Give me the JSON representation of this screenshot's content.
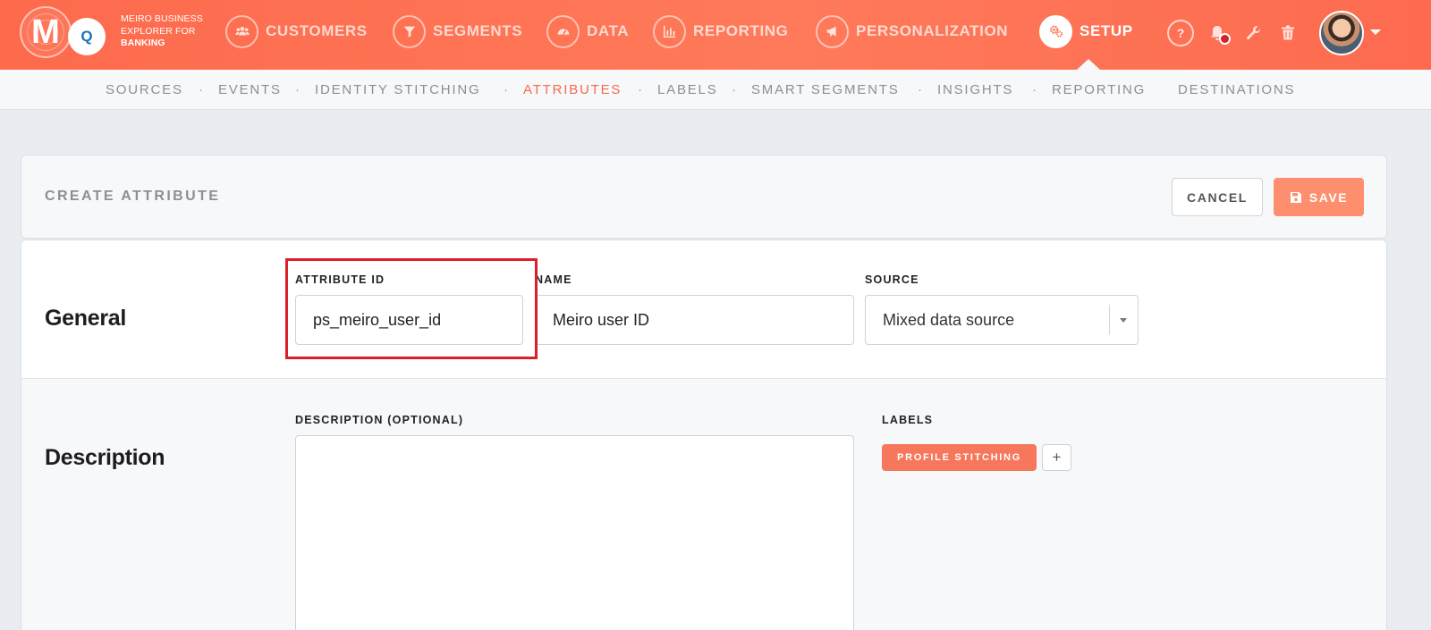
{
  "brand": {
    "logo_letter": "M",
    "logo_q": "Q",
    "line1": "MEIRO BUSINESS",
    "line2": "EXPLORER FOR",
    "line3": "BANKING"
  },
  "nav": {
    "customers": "CUSTOMERS",
    "segments": "SEGMENTS",
    "data": "DATA",
    "reporting": "REPORTING",
    "personalization": "PERSONALIZATION",
    "setup": "SETUP"
  },
  "tools": {
    "help": "?"
  },
  "subnav": {
    "sources": "SOURCES",
    "events": "EVENTS",
    "identity_stitching": "IDENTITY STITCHING",
    "attributes": "ATTRIBUTES",
    "labels": "LABELS",
    "smart_segments": "SMART SEGMENTS",
    "insights": "INSIGHTS",
    "reporting": "REPORTING",
    "destinations": "DESTINATIONS",
    "separator": "·"
  },
  "header": {
    "title": "CREATE ATTRIBUTE",
    "cancel_label": "CANCEL",
    "save_label": "SAVE"
  },
  "general": {
    "title": "General",
    "attribute_id_label": "ATTRIBUTE ID",
    "attribute_id_value": "ps_meiro_user_id",
    "name_label": "NAME",
    "name_value": "Meiro user ID",
    "source_label": "SOURCE",
    "source_value": "Mixed data source"
  },
  "description": {
    "title": "Description",
    "description_label": "DESCRIPTION (OPTIONAL)",
    "description_value": "",
    "labels_label": "LABELS",
    "tags": [
      "PROFILE STITCHING"
    ],
    "add_label": "+"
  },
  "colors": {
    "brand_orange": "#fd6a4c",
    "accent_active": "#f56a4c",
    "save_button": "#fe8f6e",
    "label_tag": "#f6775b",
    "highlight": "#dc1f28"
  }
}
